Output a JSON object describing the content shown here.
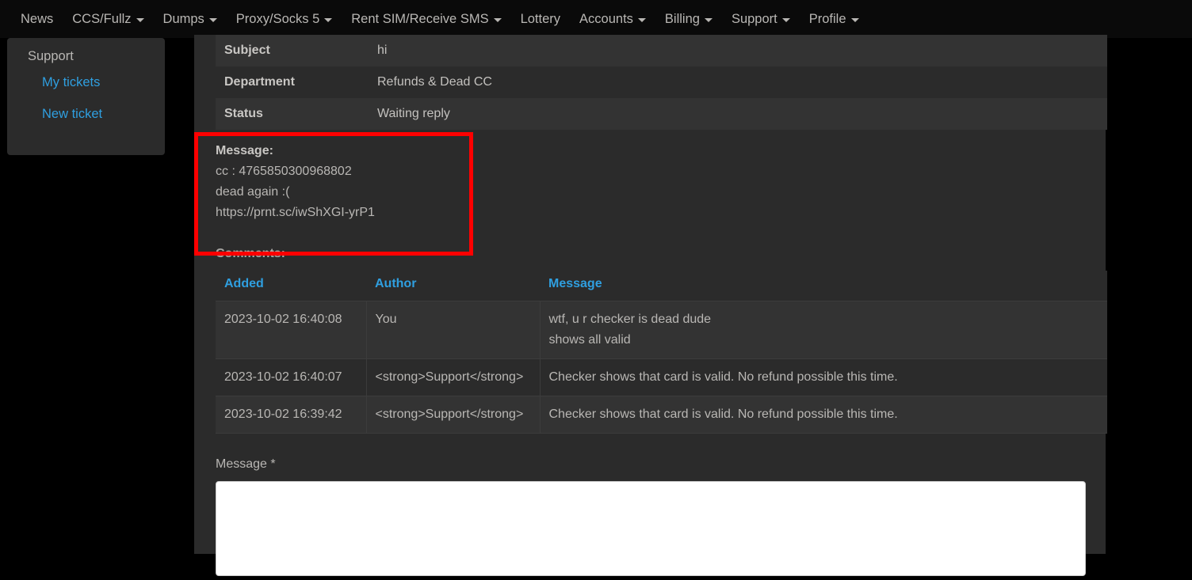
{
  "navbar": {
    "items": [
      {
        "label": "News",
        "has_caret": false
      },
      {
        "label": "CCS/Fullz",
        "has_caret": true
      },
      {
        "label": "Dumps",
        "has_caret": true
      },
      {
        "label": "Proxy/Socks 5",
        "has_caret": true
      },
      {
        "label": "Rent SIM/Receive SMS",
        "has_caret": true
      },
      {
        "label": "Lottery",
        "has_caret": false
      },
      {
        "label": "Accounts",
        "has_caret": true
      },
      {
        "label": "Billing",
        "has_caret": true
      },
      {
        "label": "Support",
        "has_caret": true
      },
      {
        "label": "Profile",
        "has_caret": true
      }
    ]
  },
  "sidebar": {
    "heading": "Support",
    "links": [
      {
        "label": "My tickets"
      },
      {
        "label": "New ticket"
      }
    ]
  },
  "ticket": {
    "rows": [
      {
        "key": "Subject",
        "value": "hi"
      },
      {
        "key": "Department",
        "value": "Refunds & Dead CC"
      },
      {
        "key": "Status",
        "value": "Waiting reply"
      }
    ],
    "message_label": "Message:",
    "message_lines": [
      "cc : 4765850300968802",
      "dead again :(",
      "https://prnt.sc/iwShXGI-yrP1"
    ],
    "comments_label": "Comments:"
  },
  "comments": {
    "headers": [
      "Added",
      "Author",
      "Message"
    ],
    "rows": [
      {
        "added": "2023-10-02 16:40:08",
        "author": "You",
        "message": "wtf, u r checker is dead dude\nshows all valid"
      },
      {
        "added": "2023-10-02 16:40:07",
        "author": "<strong>Support</strong>",
        "message": "Checker shows that card is valid. No refund possible this time."
      },
      {
        "added": "2023-10-02 16:39:42",
        "author": "<strong>Support</strong>",
        "message": "Checker shows that card is valid. No refund possible this time."
      }
    ]
  },
  "reply_form": {
    "message_label": "Message *",
    "message_value": "",
    "message_placeholder": ""
  },
  "colors": {
    "navbar_bg": "#0a0a0a",
    "page_bg": "#000000",
    "panel_bg": "#2b2b2b",
    "stripe_bg": "#333333",
    "link": "#2f9fe0",
    "text": "#b9b7b4",
    "highlight_box": "#ff0000"
  }
}
